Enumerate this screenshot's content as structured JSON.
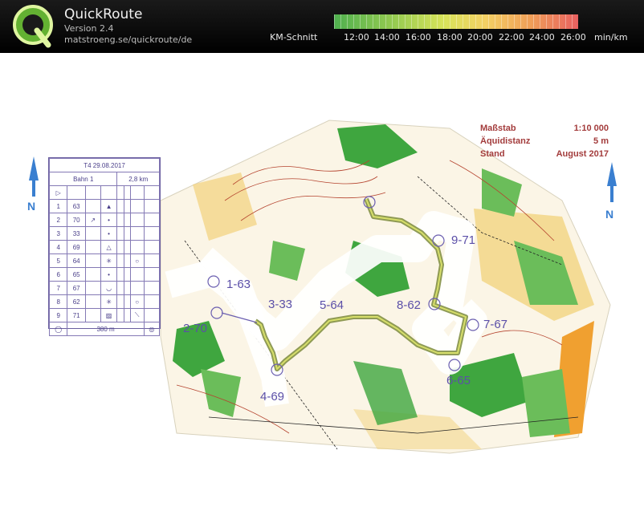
{
  "app": {
    "title": "QuickRoute",
    "version": "Version 2.4",
    "url": "matstroeng.se/quickroute/de"
  },
  "pace_scale": {
    "label": "KM-Schnitt",
    "ticks": [
      "12:00",
      "14:00",
      "16:00",
      "18:00",
      "20:00",
      "22:00",
      "24:00",
      "26:00"
    ],
    "unit": "min/km",
    "colors": {
      "fast": "#4fb04f",
      "mid": "#d8e35a",
      "slow": "#e86060"
    }
  },
  "map_legend": {
    "rows": [
      {
        "key": "Maßstab",
        "value": "1:10 000"
      },
      {
        "key": "Äquidistanz",
        "value": "5 m"
      },
      {
        "key": "Stand",
        "value": "August 2017"
      }
    ]
  },
  "control_card": {
    "title": "T4 29.08.2017",
    "course": "Bahn 1",
    "length": "2,8 km",
    "rows": [
      {
        "num": "1",
        "code": "63"
      },
      {
        "num": "2",
        "code": "70"
      },
      {
        "num": "3",
        "code": "33"
      },
      {
        "num": "4",
        "code": "69"
      },
      {
        "num": "5",
        "code": "64"
      },
      {
        "num": "6",
        "code": "65"
      },
      {
        "num": "7",
        "code": "67"
      },
      {
        "num": "8",
        "code": "62"
      },
      {
        "num": "9",
        "code": "71"
      }
    ],
    "finish_distance": "380 m"
  },
  "controls": [
    "1-63",
    "2-70",
    "3-33",
    "4-69",
    "5-64",
    "6-65",
    "7-67",
    "8-62",
    "9-71"
  ],
  "colors": {
    "route": "#7b8a3a",
    "course": "#8b6fc8",
    "forest": "#3fa63f",
    "open": "#f2d27a",
    "contour": "#b5442f"
  }
}
